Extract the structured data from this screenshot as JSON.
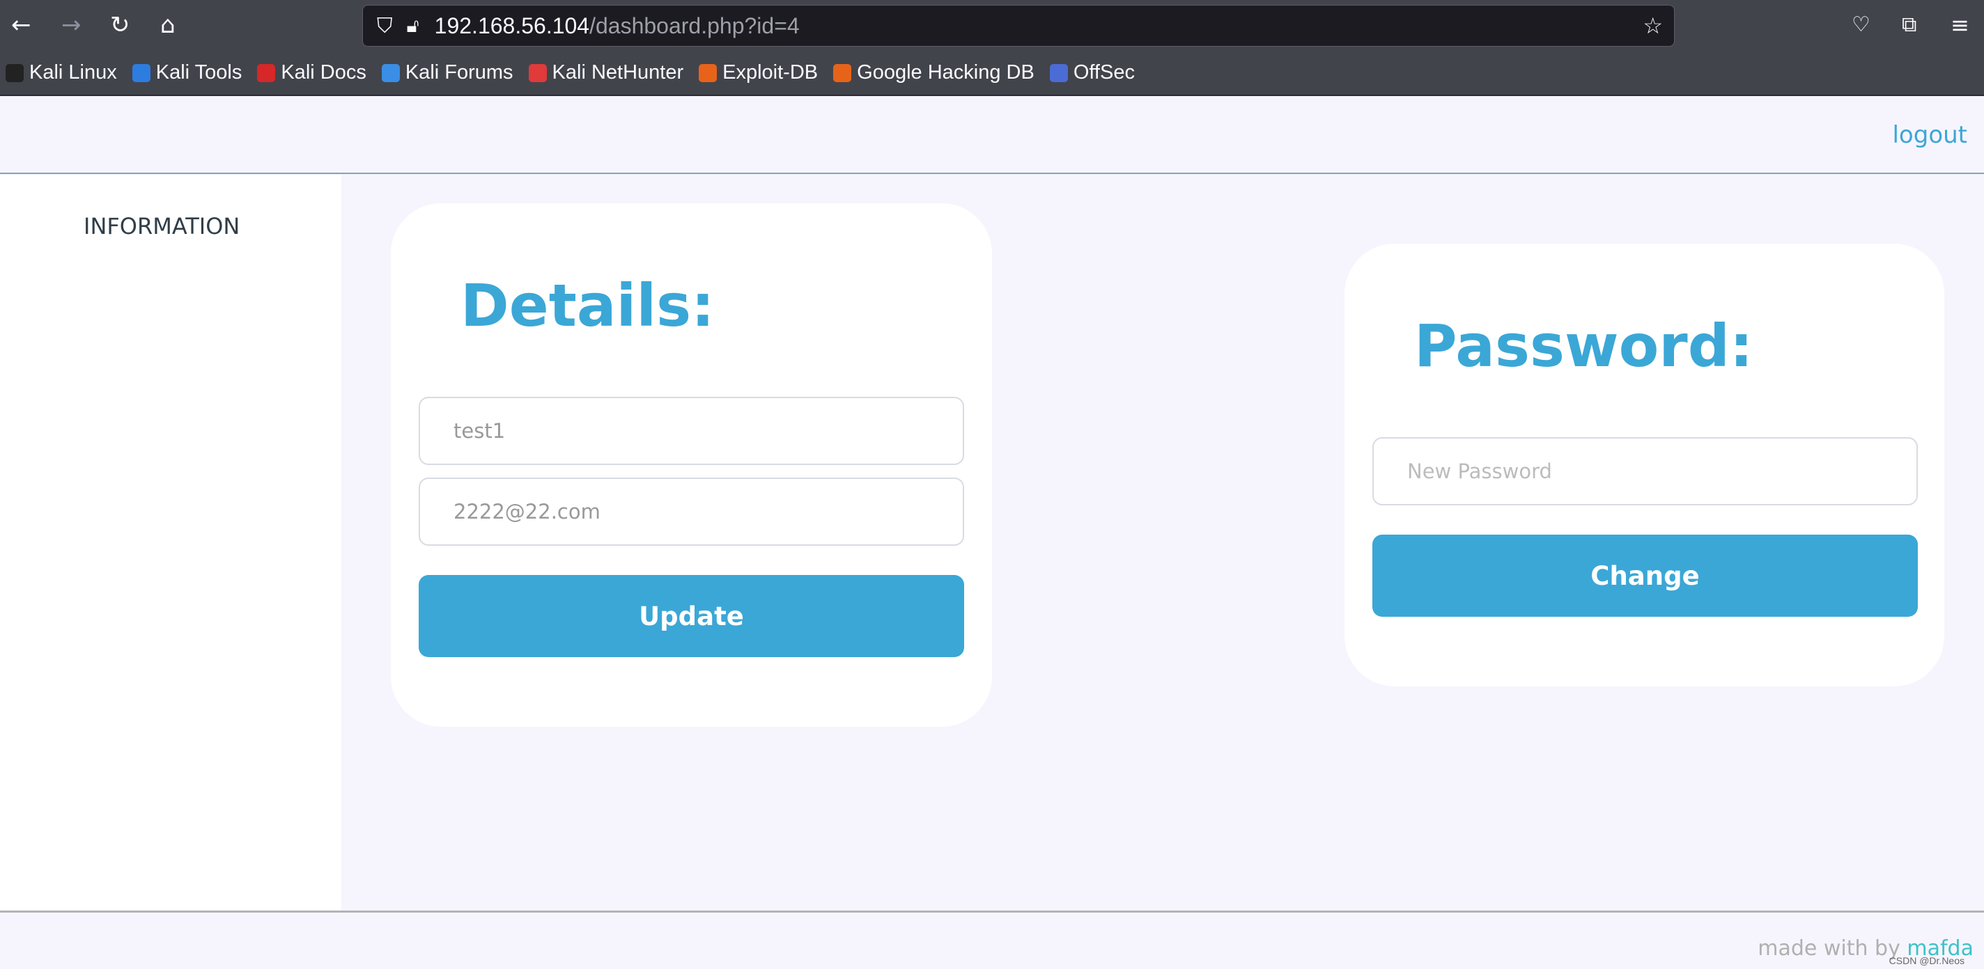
{
  "browser": {
    "url_host": "192.168.56.104",
    "url_path": "/dashboard.php?id=4",
    "bookmarks": [
      {
        "label": "Kali Linux",
        "color": "#222"
      },
      {
        "label": "Kali Tools",
        "color": "#2d7de0"
      },
      {
        "label": "Kali Docs",
        "color": "#d62828"
      },
      {
        "label": "Kali Forums",
        "color": "#3a8ee6"
      },
      {
        "label": "Kali NetHunter",
        "color": "#e03a3a"
      },
      {
        "label": "Exploit-DB",
        "color": "#e8631a"
      },
      {
        "label": "Google Hacking DB",
        "color": "#e8631a"
      },
      {
        "label": "OffSec",
        "color": "#4a6cd4"
      }
    ]
  },
  "header": {
    "logout": "logout"
  },
  "sidebar": {
    "information": "INFORMATION"
  },
  "details": {
    "title": "Details:",
    "name_value": "test1",
    "email_value": "2222@22.com",
    "update_label": "Update"
  },
  "password": {
    "title": "Password:",
    "placeholder": "New Password",
    "change_label": "Change"
  },
  "footer": {
    "made_with": "made with by ",
    "author": "mafda",
    "watermark": "CSDN @Dr.Neos"
  },
  "colors": {
    "accent": "#3ba7d6",
    "background": "#f6f5fe"
  }
}
